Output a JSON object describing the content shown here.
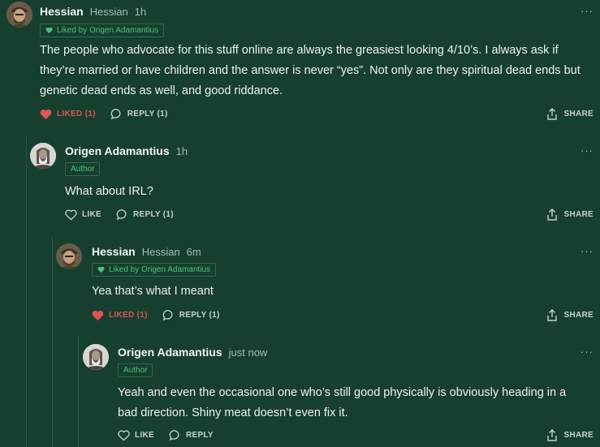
{
  "comments": [
    {
      "author": "Hessian",
      "handle": "Hessian",
      "time": "1h",
      "liked_by": "Liked by Origen Adamantius",
      "text": "The people who advocate for this stuff online are always the greasiest looking 4/10’s. I always ask if they’re married or have children and the answer is never “yes”. Not only are they spiritual dead ends but genetic dead ends as well, and good riddance.",
      "like_label": "LIKED (1)",
      "reply_label": "REPLY (1)",
      "share_label": "SHARE",
      "more": "···"
    },
    {
      "author": "Origen Adamantius",
      "time": "1h",
      "author_tag": "Author",
      "text": "What about IRL?",
      "like_label": "LIKE",
      "reply_label": "REPLY (1)",
      "share_label": "SHARE",
      "more": "···"
    },
    {
      "author": "Hessian",
      "handle": "Hessian",
      "time": "6m",
      "liked_by": "Liked by Origen Adamantius",
      "text": "Yea that’s what I meant",
      "like_label": "LIKED (1)",
      "reply_label": "REPLY (1)",
      "share_label": "SHARE",
      "more": "···"
    },
    {
      "author": "Origen Adamantius",
      "time": "just now",
      "author_tag": "Author",
      "text": "Yeah and even the occasional one who’s still good physically is obviously heading in a bad direction. Shiny meat doesn’t even fix it.",
      "like_label": "LIKE",
      "reply_label": "REPLY",
      "share_label": "SHARE",
      "more": "···"
    }
  ],
  "colors": {
    "background": "#163f2e",
    "accent_green": "#4ec07d",
    "liked_red": "#e0555a"
  }
}
